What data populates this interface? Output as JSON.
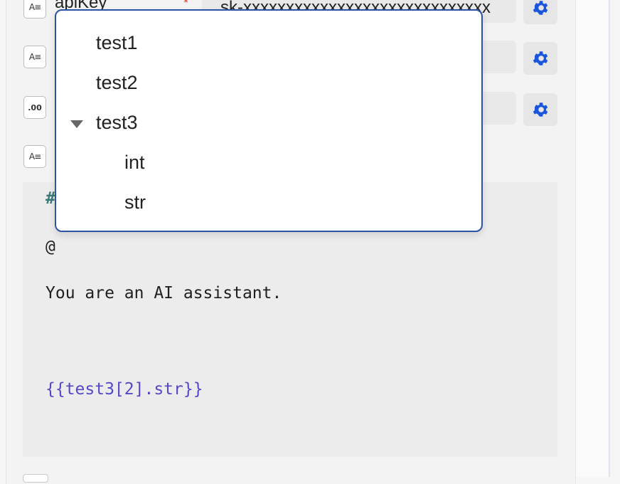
{
  "params": [
    {
      "name": "apiKey",
      "required": "*",
      "type_icon": "text-type-icon",
      "value": "sk-xxxxxxxxxxxxxxxxxxxxxxxxxxxxx"
    },
    {
      "name": "",
      "type_icon": "text-type-icon",
      "value": ""
    },
    {
      "name": "",
      "type_icon": "number-type-icon",
      "value": ""
    },
    {
      "name": "",
      "type_icon": "text-type-icon",
      "value": ""
    }
  ],
  "icons": {
    "text_type": "A≡",
    "number_type": ".00"
  },
  "editor": {
    "lines": [
      "#",
      "@",
      "You are an AI assistant.",
      "{{test3[2].str}}"
    ]
  },
  "dropdown": {
    "items": [
      {
        "label": "test1",
        "level": 0
      },
      {
        "label": "test2",
        "level": 0
      },
      {
        "label": "test3",
        "level": 0,
        "expanded": true
      },
      {
        "label": "int",
        "level": 1
      },
      {
        "label": "str",
        "level": 1
      }
    ]
  },
  "colors": {
    "accent": "#2b55a4",
    "gear": "#1a56db",
    "required": "#e2342b",
    "variable": "#5548c8"
  }
}
